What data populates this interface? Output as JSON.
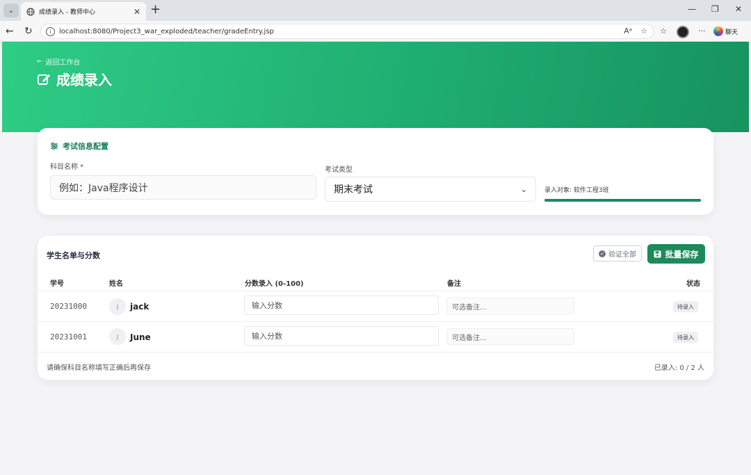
{
  "browser": {
    "tab_title": "成绩录入 - 教师中心",
    "url": "localhost:8080/Project3_war_exploded/teacher/gradeEntry.jsp",
    "chat_label": "聊天"
  },
  "header": {
    "back_label": "返回工作台",
    "title": "成绩录入"
  },
  "config": {
    "section_title": "考试信息配置",
    "subject_label": "科目名称 *",
    "subject_placeholder": "例如：Java程序设计",
    "exam_type_label": "考试类型",
    "exam_type_value": "期末考试",
    "target_text": "录入对象: 软件工程3班",
    "progress_fraction": 1.0,
    "accent_color": "#1d8a5c"
  },
  "list": {
    "title": "学生名单与分数",
    "verify_label": "验证全部",
    "save_label": "批量保存",
    "columns": {
      "id": "学号",
      "name": "姓名",
      "score": "分数录入 (0-100)",
      "note": "备注",
      "status": "状态"
    },
    "rows": [
      {
        "id": "20231000",
        "initial": "J",
        "name": "jack",
        "score_placeholder": "输入分数",
        "note_placeholder": "可选备注...",
        "status": "待录入"
      },
      {
        "id": "20231001",
        "initial": "J",
        "name": "June",
        "score_placeholder": "输入分数",
        "note_placeholder": "可选备注...",
        "status": "待录入"
      }
    ],
    "footer_hint": "请确保科目名称填写正确后再保存",
    "footer_count": "已录入: 0 / 2 人"
  }
}
